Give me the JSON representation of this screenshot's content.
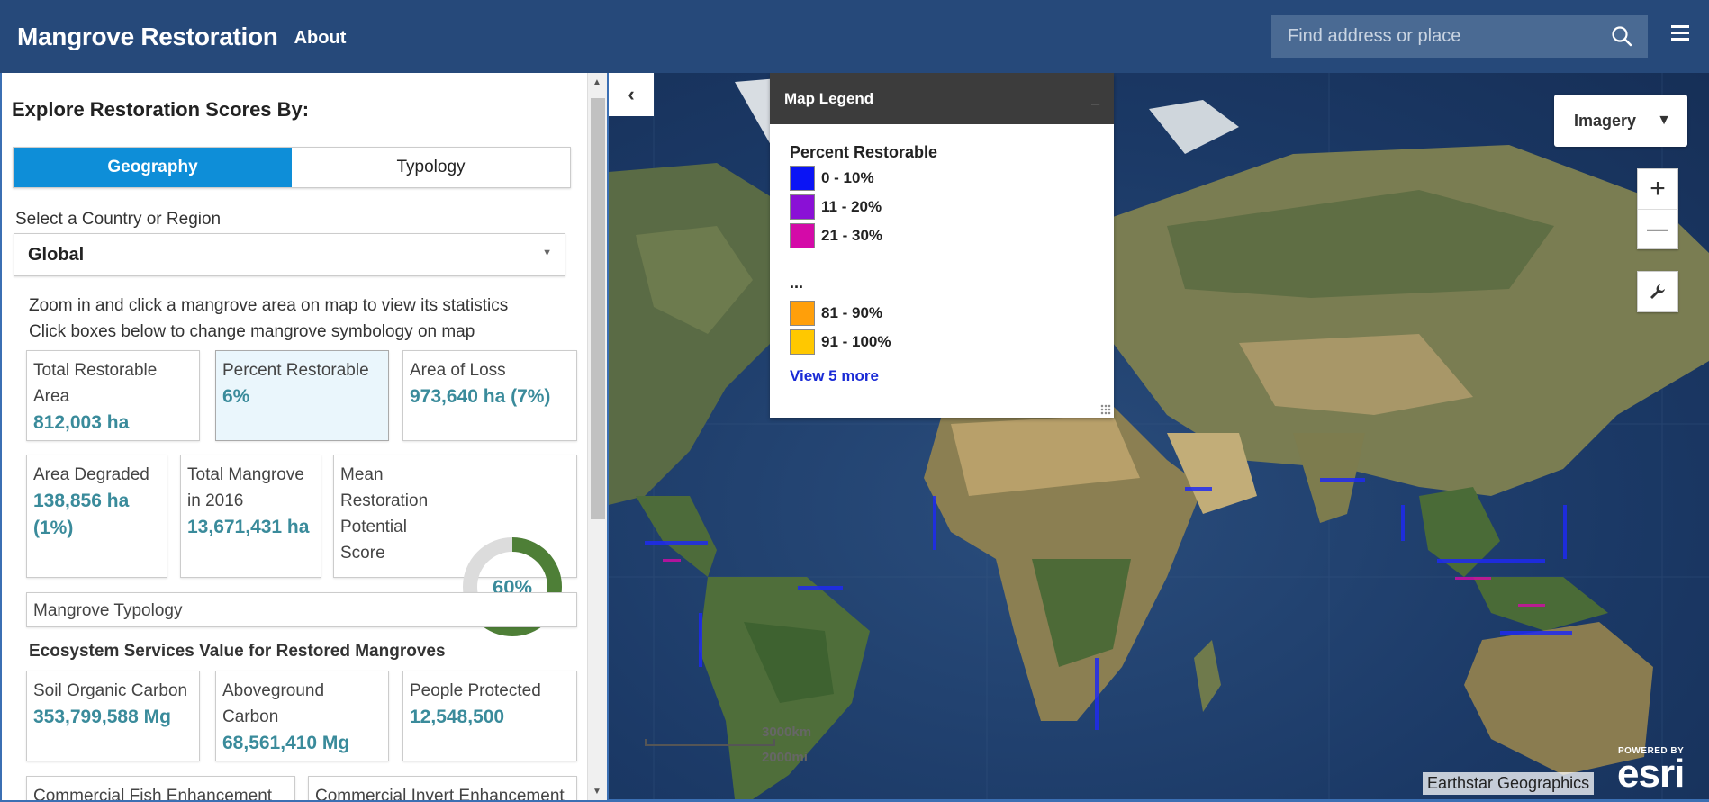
{
  "header": {
    "title": "Mangrove Restoration",
    "about": "About",
    "search_placeholder": "Find address or place"
  },
  "panel": {
    "heading": "Explore Restoration Scores By:",
    "tabs": [
      {
        "label": "Geography",
        "active": true
      },
      {
        "label": "Typology",
        "active": false
      }
    ],
    "select_label": "Select a Country or Region",
    "select_value": "Global",
    "help": [
      "Zoom in and click a mangrove area on map to view its statistics",
      "Click boxes below to change mangrove symbology on map"
    ],
    "stats": {
      "total_restorable": {
        "label": "Total Restorable Area",
        "value": "812,003 ha"
      },
      "percent_restorable": {
        "label": "Percent Restorable",
        "value": "6%"
      },
      "area_loss": {
        "label": "Area of Loss",
        "value": "973,640 ha (7%)"
      },
      "area_degraded": {
        "label": "Area Degraded",
        "value": "138,856 ha (1%)"
      },
      "total_mangrove": {
        "label": "Total Mangrove in 2016",
        "value": "13,671,431 ha"
      },
      "mean_score": {
        "label": "Mean Restoration Potential Score",
        "value": "60%",
        "fraction": 0.6
      }
    },
    "typology_label": "Mangrove Typology",
    "ecosystem_title": "Ecosystem Services Value for Restored Mangroves",
    "ecosystem": {
      "soil_carbon": {
        "label": "Soil Organic Carbon",
        "value": "353,799,588 Mg"
      },
      "aboveground_carbon": {
        "label": "Aboveground Carbon",
        "value": "68,561,410 Mg"
      },
      "people_protected": {
        "label": "People Protected",
        "value": "12,548,500"
      },
      "fish": {
        "label": "Commercial Fish Enhancement"
      },
      "invert": {
        "label": "Commercial Invert Enhancement"
      }
    }
  },
  "legend": {
    "title": "Map Legend",
    "minimize": "_",
    "subtitle": "Percent Restorable",
    "items": [
      {
        "label": "0 - 10%",
        "color": "#0a14f5"
      },
      {
        "label": "11 - 20%",
        "color": "#8a10d6"
      },
      {
        "label": "21 - 30%",
        "color": "#d40aa8"
      },
      {
        "label": "81 - 90%",
        "color": "#ff9f0a"
      },
      {
        "label": "91 - 100%",
        "color": "#ffc800"
      }
    ],
    "ellipsis": "...",
    "more": "View 5 more"
  },
  "map": {
    "basemap": "Imagery",
    "basemap_arrow": "▼",
    "zoom_in": "+",
    "zoom_out": "—",
    "scale_km": "3000km",
    "scale_mi": "2000mi",
    "attribution": "Earthstar Geographics",
    "esri_powered": "POWERED BY",
    "esri_word": "esri",
    "collapse_glyph": "‹"
  },
  "colors": {
    "header": "#26497a",
    "accent": "#0e8ed8",
    "stat_value": "#3a8b9b",
    "donut_fill": "#4e7f37",
    "donut_track": "#dcdcdc"
  }
}
